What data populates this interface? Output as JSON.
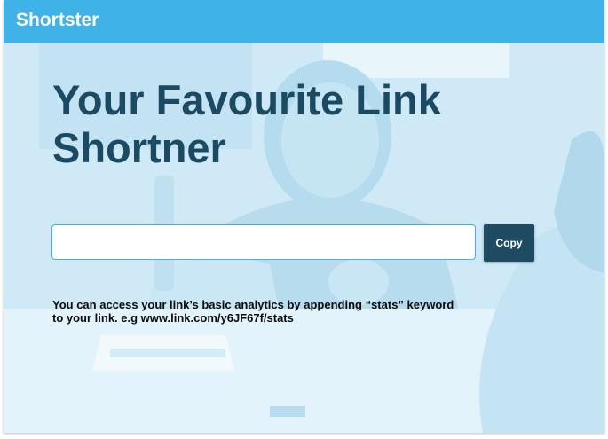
{
  "header": {
    "brand": "Shortster"
  },
  "hero": {
    "headline_line1": "Your Favourite Link",
    "headline_line2": "Shortner",
    "background_image": "office-meeting-photo"
  },
  "form": {
    "url_value": "",
    "url_placeholder": "",
    "copy_label": "Copy"
  },
  "help": {
    "line1": "You  can access  your link’s basic analytics by appending “stats”   keyword",
    "line2": "to your link. e.g www.link.com/y6JF67f/stats"
  },
  "colors": {
    "header_bg": "#3fb2e8",
    "headline": "#1b4a63",
    "button_bg": "#1e4a62",
    "overlay_tint": "#d6eef8"
  }
}
